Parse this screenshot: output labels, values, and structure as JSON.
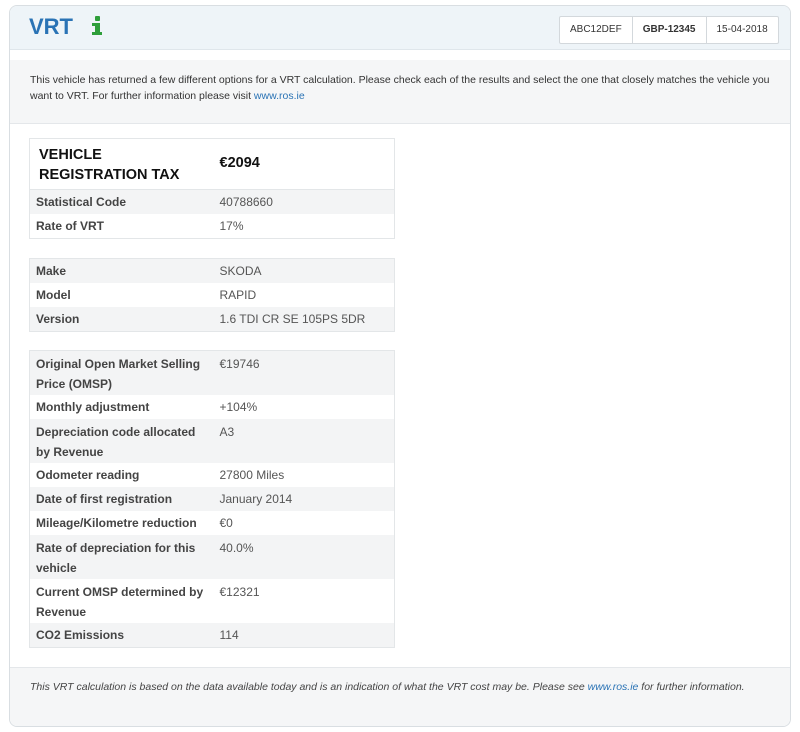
{
  "header": {
    "title": "VRT",
    "badges": [
      "ABC12DEF",
      "GBP-12345",
      "15-04-2018"
    ]
  },
  "intro": {
    "text": "This vehicle has returned a few different options for a VRT calculation. Please check each of the results and select the one that closely matches the vehicle you want to VRT. For further information please visit ",
    "link": "www.ros.ie"
  },
  "tax": {
    "label": "VEHICLE REGISTRATION TAX",
    "value": "€2094",
    "rows": [
      {
        "key": "Statistical Code",
        "value": "40788660"
      },
      {
        "key": "Rate of VRT",
        "value": "17%"
      }
    ]
  },
  "vehicle": {
    "rows": [
      {
        "key": "Make",
        "value": "SKODA"
      },
      {
        "key": "Model",
        "value": "RAPID"
      },
      {
        "key": "Version",
        "value": "1.6 TDI CR SE 105PS 5DR"
      }
    ]
  },
  "calculation": {
    "rows": [
      {
        "key": "Original Open Market Selling Price (OMSP)",
        "value": "€19746"
      },
      {
        "key": "Monthly adjustment",
        "value": "+104%"
      },
      {
        "key": "Depreciation code allocated by Revenue",
        "value": "A3"
      },
      {
        "key": "Odometer reading",
        "value": "27800 Miles"
      },
      {
        "key": "Date of first registration",
        "value": "January 2014"
      },
      {
        "key": "Mileage/Kilometre reduction",
        "value": "€0"
      },
      {
        "key": "Rate of depreciation for this vehicle",
        "value": "40.0%"
      },
      {
        "key": "Current OMSP determined by Revenue",
        "value": "€12321"
      },
      {
        "key": "CO2 Emissions",
        "value": "114"
      }
    ]
  },
  "footer": {
    "text_before": "This VRT calculation is based on the data available today and is an indication of what the VRT cost may be. Please see ",
    "link": "www.ros.ie",
    "text_after": " for further information."
  },
  "colors": {
    "accent": "#2a73b5",
    "info_icon": "#2e9e3a",
    "header_bg": "#eef4f8",
    "row_alt_bg": "#f3f4f5"
  },
  "icons": {
    "info": "info-icon"
  }
}
